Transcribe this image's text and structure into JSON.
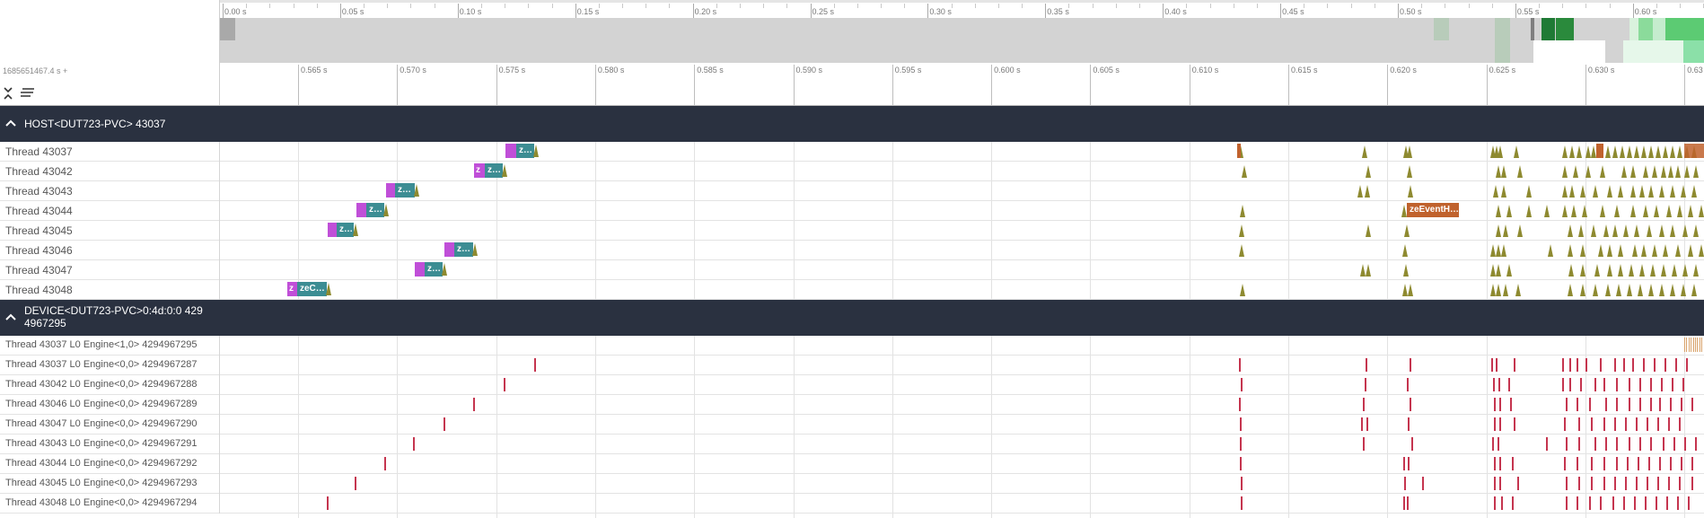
{
  "overview": {
    "ticks": [
      "0.00 s",
      "0.05 s",
      "0.10 s",
      "0.15 s",
      "0.20 s",
      "0.25 s",
      "0.30 s",
      "0.35 s",
      "0.40 s",
      "0.45 s",
      "0.50 s",
      "0.55 s",
      "0.60 s"
    ]
  },
  "timeline": {
    "epoch": "1685651467.4 s +",
    "ticks": [
      "0.565 s",
      "0.570 s",
      "0.575 s",
      "0.580 s",
      "0.585 s",
      "0.590 s",
      "0.595 s",
      "0.600 s",
      "0.605 s",
      "0.610 s",
      "0.615 s",
      "0.620 s",
      "0.625 s",
      "0.630 s",
      "0.63"
    ]
  },
  "toolbar": {
    "collapse_icon": "collapse-all-icon",
    "menu_icon": "menu-lines-icon"
  },
  "host_group": {
    "title": "HOST<DUT723-PVC> 43037",
    "chevron": "^",
    "threads": [
      "Thread 43037",
      "Thread 43042",
      "Thread 43043",
      "Thread 43044",
      "Thread 43045",
      "Thread 43046",
      "Thread 43047",
      "Thread 43048"
    ]
  },
  "slice_labels": {
    "z": "z",
    "z_dots": "z…",
    "zeC": "zeC…",
    "event": "zeEventH…"
  },
  "device_group": {
    "title_line1": "DEVICE<DUT723-PVC>0:4d:0:0 429",
    "title_line2": "4967295",
    "chevron": "^",
    "threads": [
      "Thread 43037 L0 Engine<1,0> 4294967295",
      "Thread 43037 L0 Engine<0,0> 4294967287",
      "Thread 43042 L0 Engine<0,0> 4294967288",
      "Thread 43046 L0 Engine<0,0> 4294967289",
      "Thread 43047 L0 Engine<0,0> 4294967290",
      "Thread 43043 L0 Engine<0,0> 4294967291",
      "Thread 43044 L0 Engine<0,0> 4294967292",
      "Thread 43045 L0 Engine<0,0> 4294967293",
      "Thread 43048 L0 Engine<0,0> 4294967294"
    ]
  },
  "colors": {
    "header_bg": "#2a3140",
    "slice_magenta": "#c04fd8",
    "slice_teal": "#3c8d93",
    "slice_orange": "#c0622d",
    "instant": "#8e8a30",
    "device_marker": "#c5354f",
    "overview_bg": "#d3d3d3",
    "overview_green_dark": "#2a8a3c",
    "overview_green_light": "#7fd690"
  }
}
